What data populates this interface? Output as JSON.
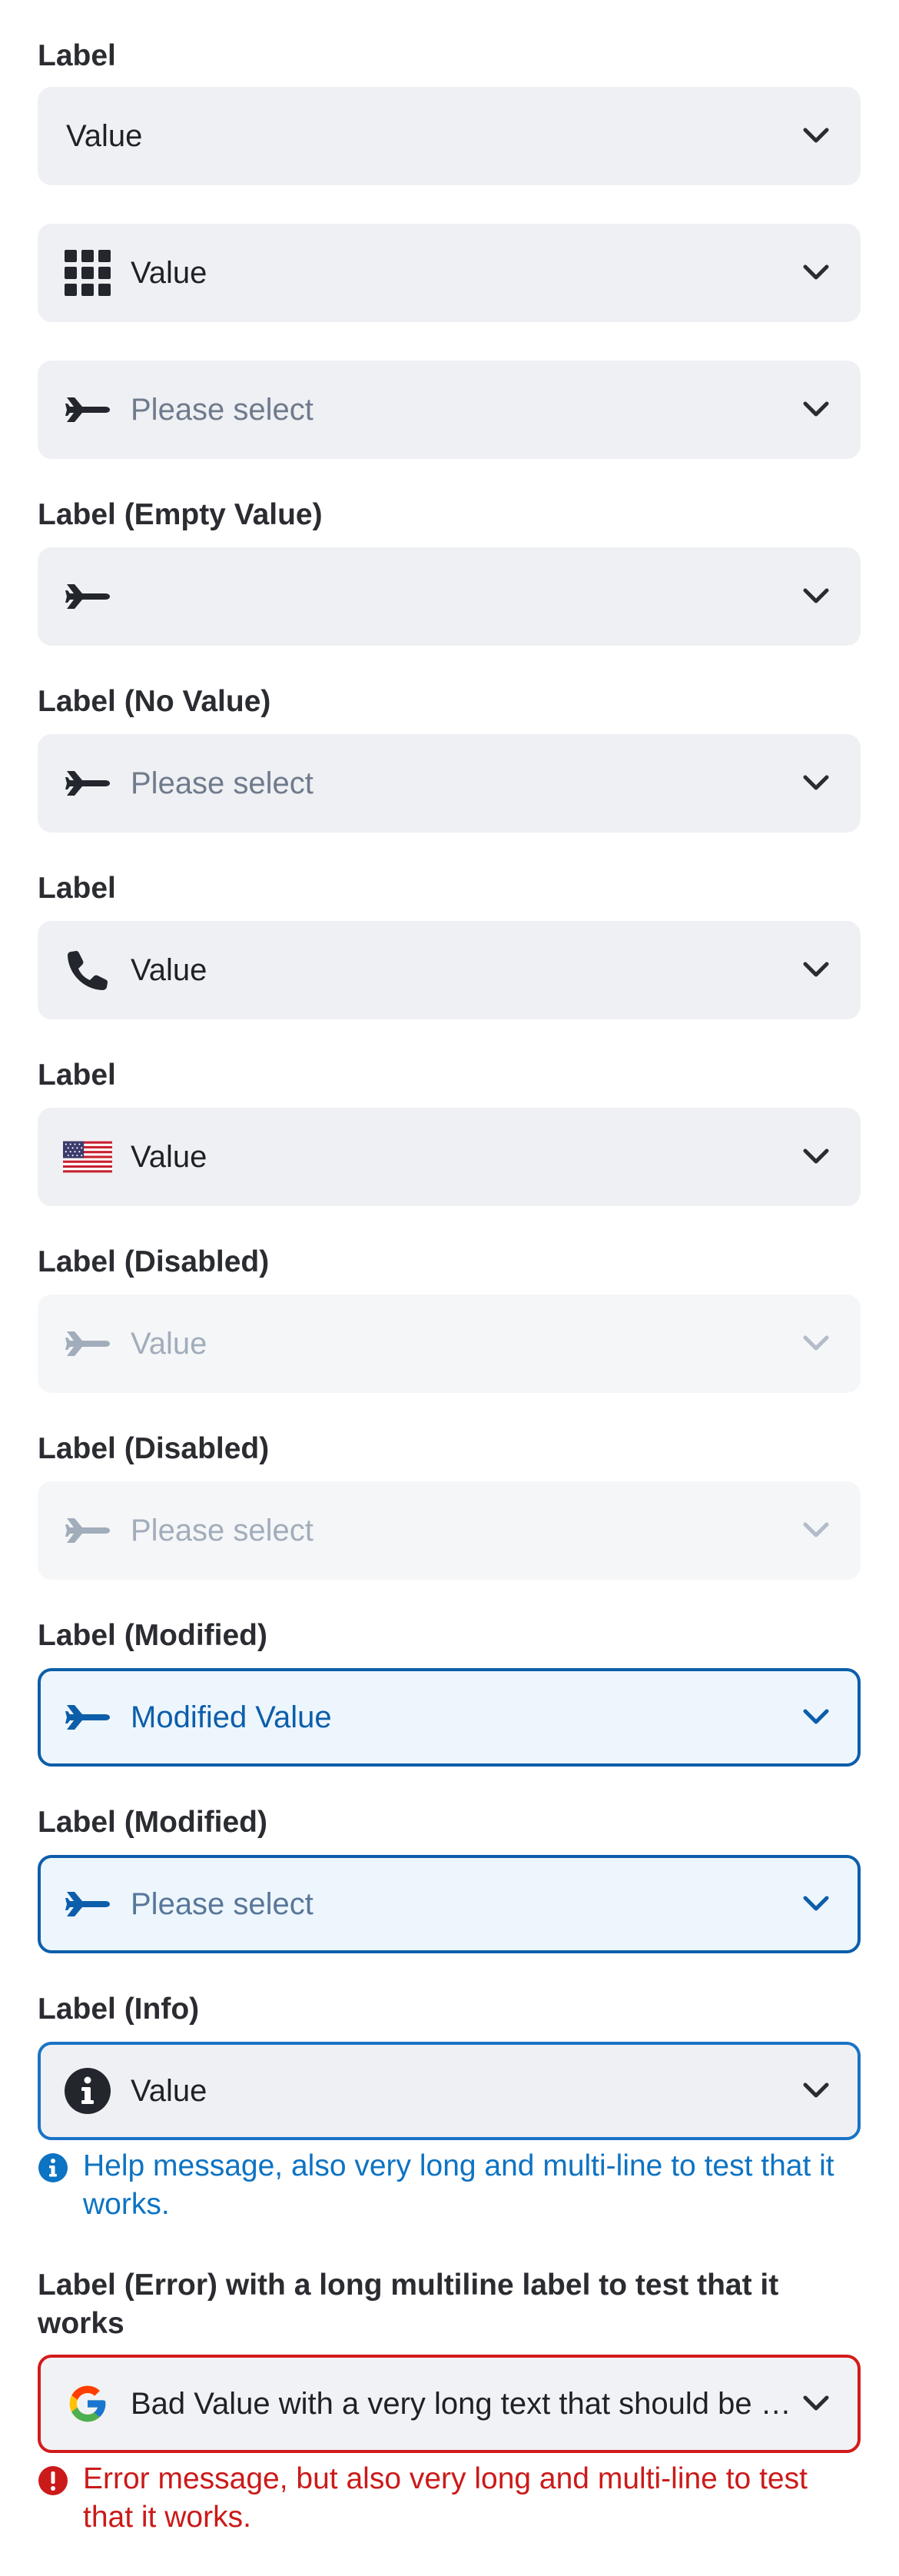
{
  "fields": [
    {
      "label": "Label",
      "value": "Value",
      "icon": "",
      "state": "default"
    },
    {
      "label": "",
      "value": "Value",
      "icon": "grid-icon",
      "state": "default"
    },
    {
      "label": "",
      "value": "Please select",
      "icon": "airplane-icon",
      "state": "placeholder"
    },
    {
      "label": "Label (Empty Value)",
      "value": "",
      "icon": "airplane-icon",
      "state": "empty"
    },
    {
      "label": "Label (No Value)",
      "value": "Please select",
      "icon": "airplane-icon",
      "state": "placeholder"
    },
    {
      "label": "Label",
      "value": "Value",
      "icon": "phone-icon",
      "state": "default"
    },
    {
      "label": "Label",
      "value": "Value",
      "icon": "us-flag-icon",
      "state": "default"
    },
    {
      "label": "Label (Disabled)",
      "value": "Value",
      "icon": "airplane-icon",
      "state": "disabled"
    },
    {
      "label": "Label (Disabled)",
      "value": "Please select",
      "icon": "airplane-icon",
      "state": "disabled-placeholder"
    },
    {
      "label": "Label (Modified)",
      "value": "Modified Value",
      "icon": "airplane-icon",
      "state": "modified"
    },
    {
      "label": "Label (Modified)",
      "value": "Please select",
      "icon": "airplane-icon",
      "state": "modified-placeholder"
    },
    {
      "label": "Label (Info)",
      "value": "Value",
      "icon": "info-circle-icon",
      "state": "info",
      "message": "Help message, also very long and multi-line to test that it works."
    },
    {
      "label": "Label (Error) with a long multiline label to test that it works",
      "value": "Bad Value with a very long text that should be truncated",
      "icon": "google-logo-icon",
      "state": "error",
      "message": "Error message, but also very long and multi-line to test that it works."
    }
  ],
  "colors": {
    "field_bg": "#eef0f3",
    "modified_border": "#0c5eaa",
    "info": "#0d73c3",
    "error": "#cb1a1a"
  }
}
